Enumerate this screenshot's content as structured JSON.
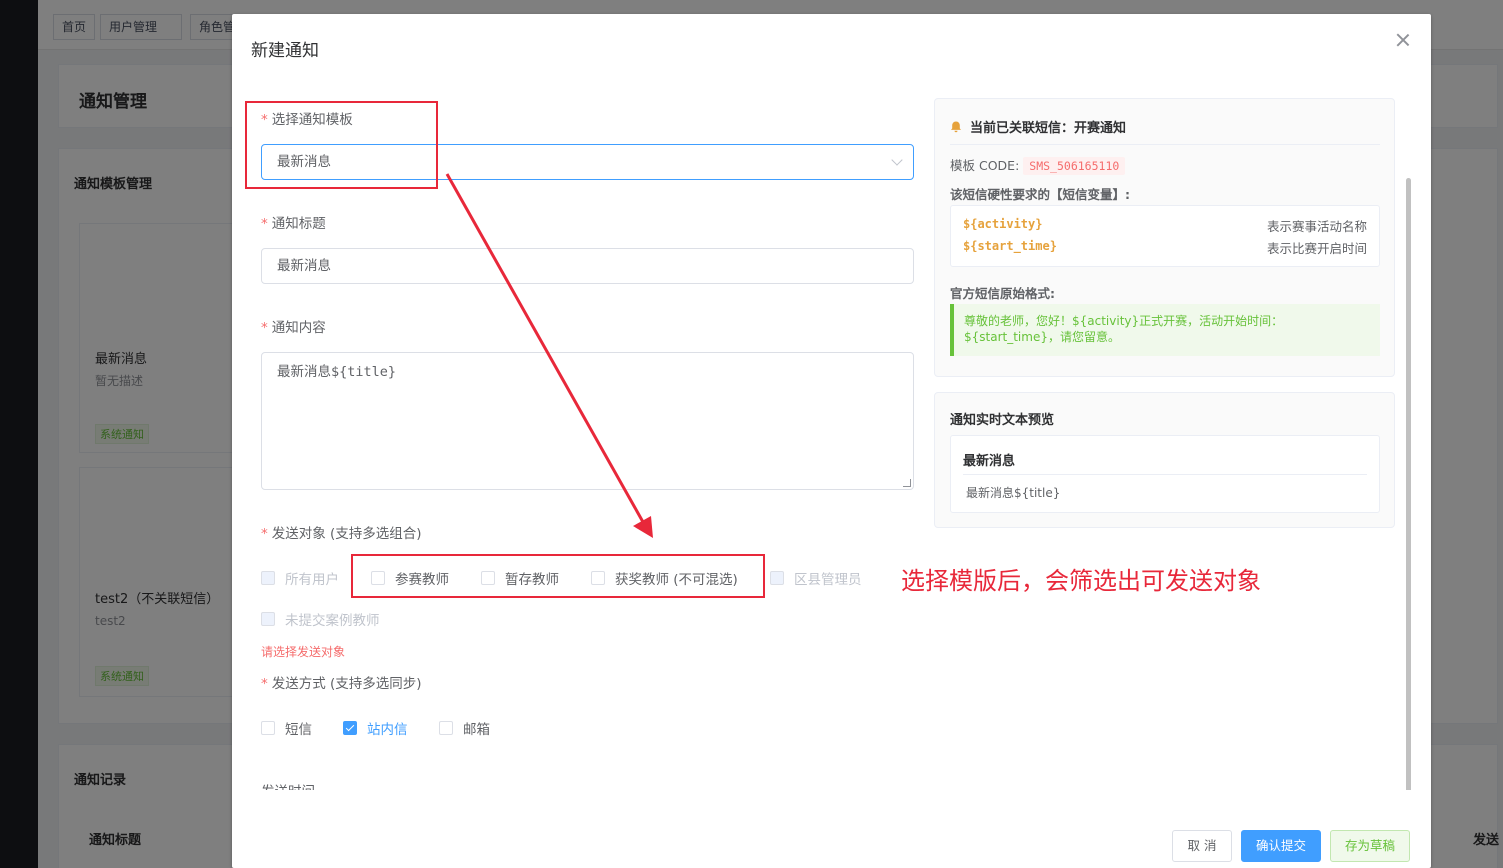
{
  "background": {
    "tabs": [
      "首页",
      "用户管理",
      "角色管"
    ],
    "page_title": "通知管理",
    "section_title": "通知模板管理",
    "card1": {
      "title": "最新消息",
      "desc": "暂无描述",
      "tag": "系统通知"
    },
    "card2": {
      "title": "test2（不关联短信）",
      "desc": "test2",
      "tag": "系统通知"
    },
    "section2_title": "通知记录",
    "col_title": "通知标题",
    "col_right": "发送"
  },
  "dialog": {
    "title": "新建通知",
    "template": {
      "label": "选择通知模板",
      "value": "最新消息"
    },
    "notice_title": {
      "label": "通知标题",
      "value": "最新消息"
    },
    "content": {
      "label": "通知内容",
      "value_prefix": "最新消息",
      "value_var": "${title}"
    },
    "targets": {
      "label": "发送对象 (支持多选组合)",
      "options": [
        {
          "label": "所有用户",
          "state": "disabled"
        },
        {
          "label": "参赛教师",
          "state": "normal"
        },
        {
          "label": "暂存教师",
          "state": "normal"
        },
        {
          "label": "获奖教师 (不可混选)",
          "state": "normal"
        },
        {
          "label": "区县管理员",
          "state": "disabled"
        },
        {
          "label": "未提交案例教师",
          "state": "disabled"
        }
      ],
      "error": "请选择发送对象"
    },
    "methods": {
      "label": "发送方式 (支持多选同步)",
      "options": [
        {
          "label": "短信",
          "checked": false
        },
        {
          "label": "站内信",
          "checked": true
        },
        {
          "label": "邮箱",
          "checked": false
        }
      ]
    },
    "send_time_label": "发送时间",
    "sms_panel": {
      "header": "当前已关联短信：开赛通知",
      "code_label": "模板 CODE:",
      "code_value": "SMS_506165110",
      "vars_label": "该短信硬性要求的【短信变量】:",
      "vars": [
        {
          "name": "${activity}",
          "desc": "表示赛事活动名称"
        },
        {
          "name": "${start_time}",
          "desc": "表示比赛开启时间"
        }
      ],
      "format_label": "官方短信原始格式:",
      "format_text": "尊敬的老师，您好！${activity}正式开赛，活动开始时间：${start_time}，请您留意。"
    },
    "preview_panel": {
      "header": "通知实时文本预览",
      "title": "最新消息",
      "body": "最新消息${title}"
    },
    "buttons": {
      "cancel": "取 消",
      "submit": "确认提交",
      "draft": "存为草稿"
    }
  },
  "annotation": {
    "text": "选择模版后，会筛选出可发送对象"
  },
  "colors": {
    "primary": "#409eff",
    "danger": "#f56c6c",
    "success": "#67c23a",
    "warning": "#e6a23c",
    "annotation": "#e8283a"
  }
}
